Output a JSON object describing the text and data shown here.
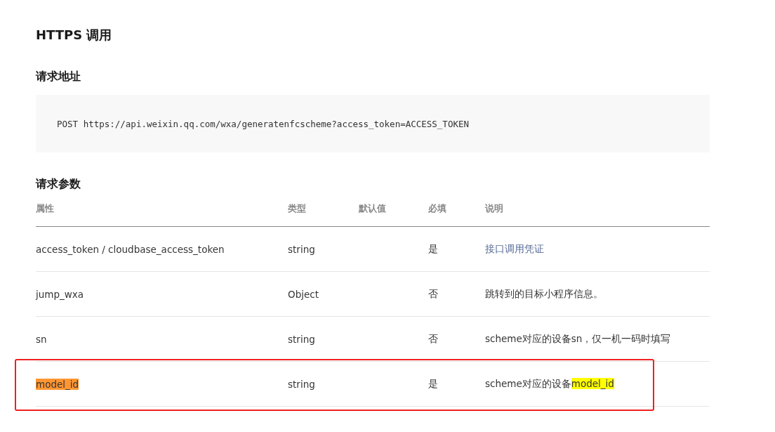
{
  "title": "HTTPS 调用",
  "address": {
    "heading": "请求地址",
    "code": "POST https://api.weixin.qq.com/wxa/generatenfcscheme?access_token=ACCESS_TOKEN"
  },
  "params": {
    "heading": "请求参数",
    "columns": [
      "属性",
      "类型",
      "默认值",
      "必填",
      "说明"
    ],
    "rows": [
      {
        "name": [
          {
            "kind": "text",
            "text": "access_token / cloudbase_access_token"
          }
        ],
        "type": "string",
        "required": "是",
        "description": [
          {
            "kind": "link",
            "text": "接口调用凭证"
          }
        ],
        "annotated": false
      },
      {
        "name": [
          {
            "kind": "text",
            "text": "jump_wxa"
          }
        ],
        "type": "Object",
        "required": "否",
        "description": [
          {
            "kind": "text",
            "text": "跳转到的目标小程序信息。"
          }
        ],
        "annotated": false
      },
      {
        "name": [
          {
            "kind": "text",
            "text": "sn"
          }
        ],
        "type": "string",
        "required": "否",
        "description": [
          {
            "kind": "text",
            "text": "scheme对应的设备sn，仅一机一码时填写"
          }
        ],
        "annotated": false
      },
      {
        "name": [
          {
            "kind": "current-match",
            "text": "model_id"
          }
        ],
        "type": "string",
        "required": "是",
        "description": [
          {
            "kind": "text",
            "text": "scheme对应的设备"
          },
          {
            "kind": "match",
            "text": "model_id"
          }
        ],
        "annotated": true
      }
    ]
  }
}
